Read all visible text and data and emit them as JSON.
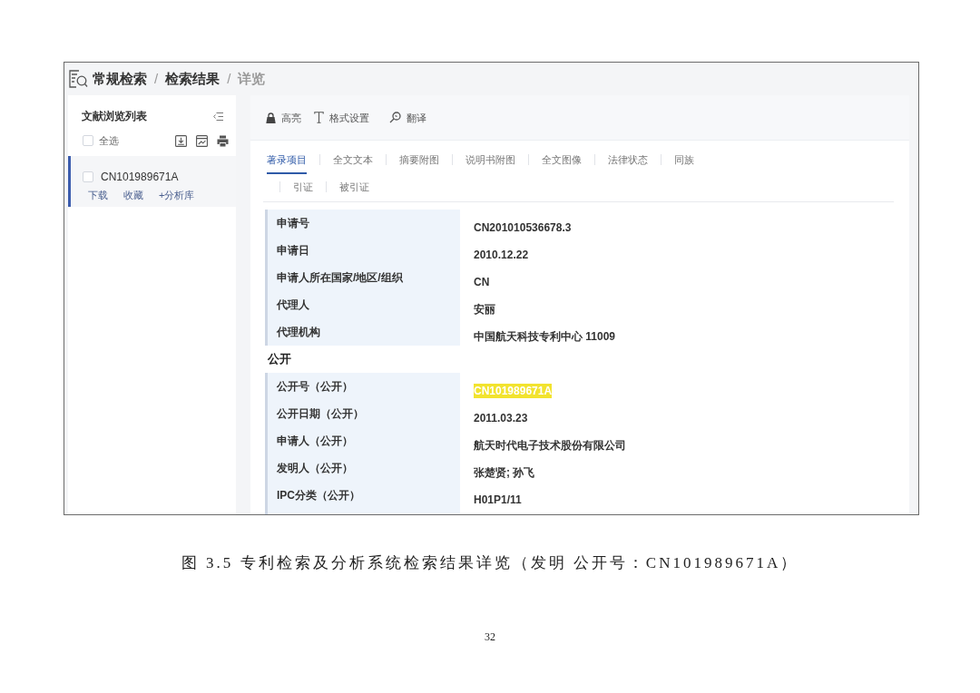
{
  "breadcrumb": {
    "items": [
      {
        "label": "常规检索",
        "current": false
      },
      {
        "label": "检索结果",
        "current": false
      },
      {
        "label": "详览",
        "current": true
      }
    ],
    "separators": [
      "/",
      "/"
    ]
  },
  "sidebar": {
    "title": "文献浏览列表",
    "select_all": {
      "label": "全选",
      "checked": false
    },
    "documents": [
      {
        "number": "CN101989671A",
        "checked": false,
        "selected": true,
        "actions": [
          "下载",
          "收藏",
          "+分析库"
        ]
      }
    ]
  },
  "toolbar": [
    {
      "label": "高亮"
    },
    {
      "label": "格式设置"
    },
    {
      "label": "翻译"
    }
  ],
  "tab_rows": [
    [
      {
        "label": "著录项目",
        "selected": true
      },
      {
        "label": "全文文本",
        "selected": false
      },
      {
        "label": "摘要附图",
        "selected": false
      },
      {
        "label": "说明书附图",
        "selected": false
      },
      {
        "label": "全文图像",
        "selected": false
      },
      {
        "label": "法律状态",
        "selected": false
      },
      {
        "label": "同族",
        "selected": false
      }
    ],
    [
      {
        "label": "引证",
        "selected": false
      },
      {
        "label": "被引证",
        "selected": false
      }
    ]
  ],
  "sections": [
    {
      "fields": [
        {
          "label": "申请号",
          "value": "CN201010536678.3",
          "highlighted": false
        },
        {
          "label": "申请日",
          "value": "2010.12.22",
          "highlighted": false
        },
        {
          "label": "申请人所在国家/地区/组织",
          "value": "CN",
          "highlighted": false
        },
        {
          "label": "代理人",
          "value": "安丽",
          "highlighted": false
        },
        {
          "label": "代理机构",
          "value": "中国航天科技专利中心 11009",
          "highlighted": false
        }
      ]
    },
    {
      "title": "公开",
      "fields": [
        {
          "label": "公开号（公开）",
          "value": "CN101989671A",
          "highlighted": true
        },
        {
          "label": "公开日期（公开）",
          "value": "2011.03.23",
          "highlighted": false
        },
        {
          "label": "申请人（公开）",
          "value": "航天时代电子技术股份有限公司",
          "highlighted": false
        },
        {
          "label": "发明人（公开）",
          "value": "张楚贤; 孙飞",
          "highlighted": false
        },
        {
          "label": "IPC分类（公开）",
          "value": "H01P1/11",
          "highlighted": false
        }
      ]
    }
  ],
  "caption": "图 3.5 专利检索及分析系统检索结果详览（发明 公开号：CN101989671A）",
  "page_number": "32"
}
